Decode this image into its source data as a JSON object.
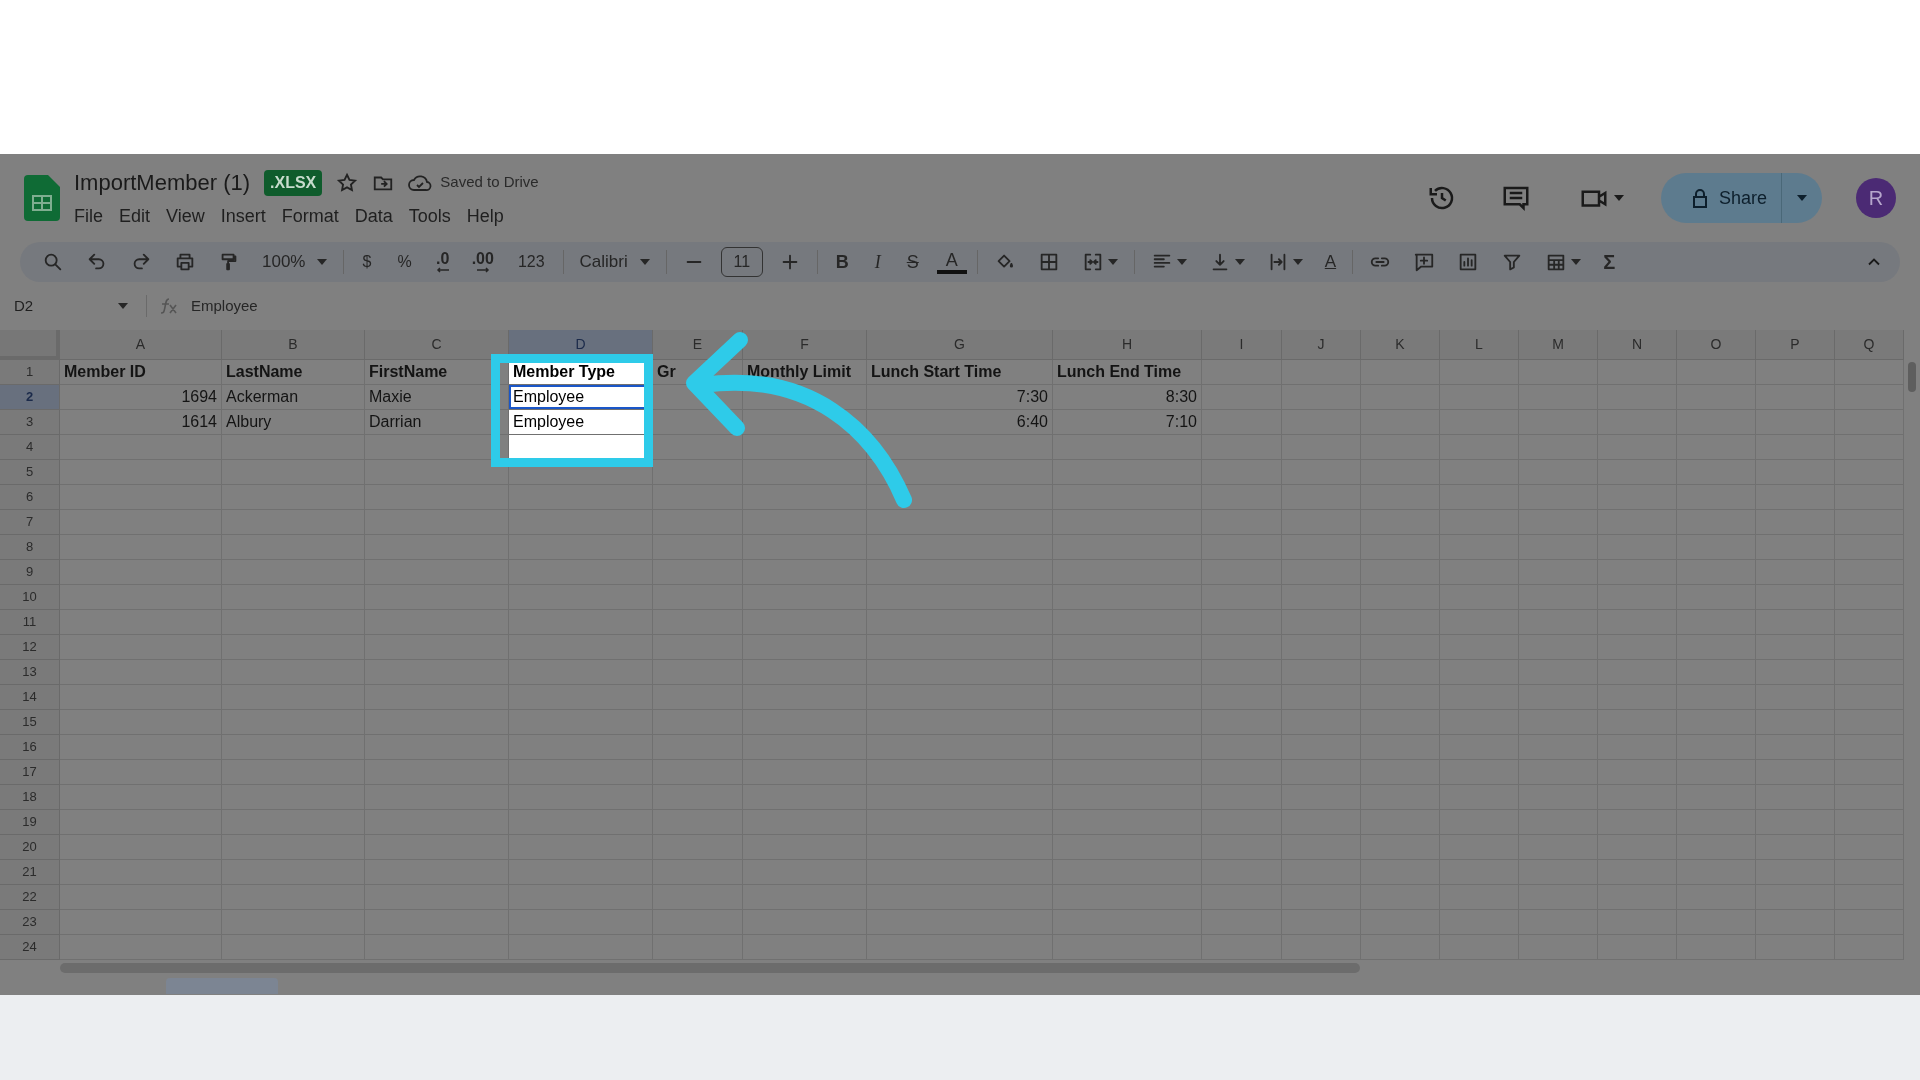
{
  "app": {
    "title": "ImportMember (1)",
    "badge": ".XLSX",
    "save_status": "Saved to Drive",
    "menu": [
      "File",
      "Edit",
      "View",
      "Insert",
      "Format",
      "Data",
      "Tools",
      "Help"
    ],
    "share": "Share",
    "avatar": "R"
  },
  "toolbar": [
    {
      "kind": "search"
    },
    {
      "kind": "undo"
    },
    {
      "kind": "redo"
    },
    {
      "kind": "print"
    },
    {
      "kind": "paint-format"
    },
    {
      "kind": "dropdown",
      "label": "100%"
    },
    {
      "kind": "separator"
    },
    {
      "kind": "text",
      "label": "$"
    },
    {
      "kind": "text",
      "label": "%"
    },
    {
      "kind": "decimal-less",
      "label": ".0"
    },
    {
      "kind": "decimal-more",
      "label": ".00"
    },
    {
      "kind": "text",
      "label": "123"
    },
    {
      "kind": "separator"
    },
    {
      "kind": "dropdown",
      "label": "Calibri"
    },
    {
      "kind": "separator"
    },
    {
      "kind": "minus"
    },
    {
      "kind": "size",
      "label": "11"
    },
    {
      "kind": "plus"
    },
    {
      "kind": "separator"
    },
    {
      "kind": "bold",
      "label": "B"
    },
    {
      "kind": "italic",
      "label": "I"
    },
    {
      "kind": "strike",
      "label": "S"
    },
    {
      "kind": "text-color",
      "label": "A"
    },
    {
      "kind": "separator"
    },
    {
      "kind": "fill"
    },
    {
      "kind": "borders"
    },
    {
      "kind": "merge"
    },
    {
      "kind": "separator"
    },
    {
      "kind": "align"
    },
    {
      "kind": "valign"
    },
    {
      "kind": "wrap"
    },
    {
      "kind": "rotate",
      "label": "A"
    },
    {
      "kind": "separator"
    },
    {
      "kind": "link"
    },
    {
      "kind": "comment"
    },
    {
      "kind": "chart"
    },
    {
      "kind": "filter"
    },
    {
      "kind": "table"
    },
    {
      "kind": "sigma",
      "label": "Σ"
    }
  ],
  "formula_bar": {
    "cell": "D2",
    "value": "Employee"
  },
  "columns": [
    {
      "label": "A",
      "selected": false
    },
    {
      "label": "B",
      "selected": false
    },
    {
      "label": "C",
      "selected": false
    },
    {
      "label": "D",
      "selected": true
    },
    {
      "label": "E",
      "selected": false
    },
    {
      "label": "F",
      "selected": false
    },
    {
      "label": "G",
      "selected": false
    },
    {
      "label": "H",
      "selected": false
    },
    {
      "label": "I",
      "selected": false
    },
    {
      "label": "J",
      "selected": false
    },
    {
      "label": "K",
      "selected": false
    },
    {
      "label": "L",
      "selected": false
    },
    {
      "label": "M",
      "selected": false
    },
    {
      "label": "N",
      "selected": false
    },
    {
      "label": "O",
      "selected": false
    },
    {
      "label": "P",
      "selected": false
    },
    {
      "label": "Q",
      "selected": false
    }
  ],
  "rows": [
    {
      "label": "1",
      "selected": false,
      "cells": [
        {
          "kind": "header",
          "text": "Member ID",
          "selected": false,
          "spotlit": false
        },
        {
          "kind": "header",
          "text": "LastName",
          "selected": false,
          "spotlit": false
        },
        {
          "kind": "header",
          "text": "FirstName",
          "selected": false,
          "spotlit": false
        },
        {
          "kind": "header",
          "text": "Member Type",
          "selected": false,
          "spotlit": true
        },
        {
          "kind": "header",
          "text": "Gr",
          "selected": false,
          "spotlit": false
        },
        {
          "kind": "header",
          "text": "Monthly Limit",
          "selected": false,
          "spotlit": false
        },
        {
          "kind": "header",
          "text": "Lunch Start Time",
          "selected": false,
          "spotlit": false
        },
        {
          "kind": "header",
          "text": "Lunch End Time",
          "selected": false,
          "spotlit": false
        }
      ]
    },
    {
      "label": "2",
      "selected": true,
      "cells": [
        {
          "kind": "number",
          "text": "1694",
          "selected": false,
          "spotlit": false
        },
        {
          "kind": "text",
          "text": "Ackerman",
          "selected": false,
          "spotlit": false
        },
        {
          "kind": "text",
          "text": "Maxie",
          "selected": false,
          "spotlit": false
        },
        {
          "kind": "text",
          "text": "Employee",
          "selected": true,
          "spotlit": true
        },
        {
          "kind": "blank",
          "selected": false,
          "spotlit": false
        },
        {
          "kind": "blank",
          "selected": false,
          "spotlit": false
        },
        {
          "kind": "number",
          "text": "7:30",
          "selected": false,
          "spotlit": false
        },
        {
          "kind": "number",
          "text": "8:30",
          "selected": false,
          "spotlit": false
        }
      ]
    },
    {
      "label": "3",
      "selected": false,
      "cells": [
        {
          "kind": "number",
          "text": "1614",
          "selected": false,
          "spotlit": false
        },
        {
          "kind": "text",
          "text": "Albury",
          "selected": false,
          "spotlit": false
        },
        {
          "kind": "text",
          "text": "Darrian",
          "selected": false,
          "spotlit": false
        },
        {
          "kind": "text",
          "text": "Employee",
          "selected": false,
          "spotlit": true
        },
        {
          "kind": "blank",
          "selected": false,
          "spotlit": false
        },
        {
          "kind": "blank",
          "selected": false,
          "spotlit": false
        },
        {
          "kind": "number",
          "text": "6:40",
          "selected": false,
          "spotlit": false
        },
        {
          "kind": "number",
          "text": "7:10",
          "selected": false,
          "spotlit": false
        }
      ]
    },
    {
      "label": "4",
      "selected": false,
      "cells": [
        {
          "kind": "blank",
          "selected": false,
          "spotlit": false
        },
        {
          "kind": "blank",
          "selected": false,
          "spotlit": false
        },
        {
          "kind": "blank",
          "selected": false,
          "spotlit": false
        },
        {
          "kind": "blank",
          "selected": false,
          "spotlit": true
        },
        {
          "kind": "blank",
          "selected": false,
          "spotlit": false
        },
        {
          "kind": "blank",
          "selected": false,
          "spotlit": false
        },
        {
          "kind": "blank",
          "selected": false,
          "spotlit": false
        },
        {
          "kind": "blank",
          "selected": false,
          "spotlit": false
        }
      ]
    },
    {
      "label": "5",
      "selected": false
    },
    {
      "label": "6",
      "selected": false
    },
    {
      "label": "7",
      "selected": false
    },
    {
      "label": "8",
      "selected": false
    },
    {
      "label": "9",
      "selected": false
    },
    {
      "label": "10",
      "selected": false
    },
    {
      "label": "11",
      "selected": false
    },
    {
      "label": "12",
      "selected": false
    },
    {
      "label": "13",
      "selected": false
    },
    {
      "label": "14",
      "selected": false
    },
    {
      "label": "15",
      "selected": false
    },
    {
      "label": "16",
      "selected": false
    },
    {
      "label": "17",
      "selected": false
    },
    {
      "label": "18",
      "selected": false
    },
    {
      "label": "19",
      "selected": false
    },
    {
      "label": "20",
      "selected": false
    },
    {
      "label": "21",
      "selected": false
    },
    {
      "label": "22",
      "selected": false
    },
    {
      "label": "23",
      "selected": false
    },
    {
      "label": "24",
      "selected": false
    }
  ]
}
